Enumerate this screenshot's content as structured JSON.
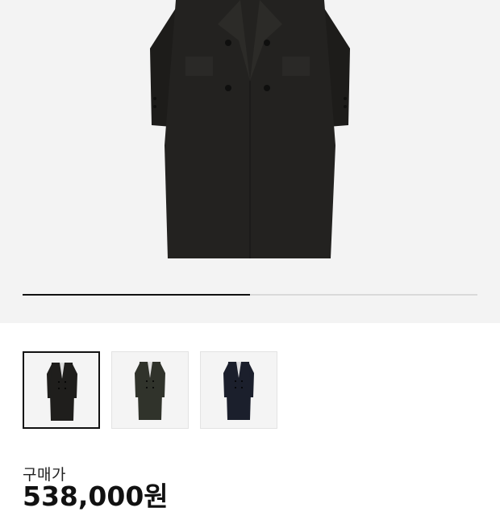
{
  "carousel": {
    "progress": 0.5,
    "colors": {
      "track": "#d9d9d9",
      "fill": "#111111"
    }
  },
  "thumbnails": [
    {
      "name": "black",
      "color": "#1f1e1c",
      "selected": true
    },
    {
      "name": "dark-olive",
      "color": "#30332b",
      "selected": false
    },
    {
      "name": "navy",
      "color": "#1b1f2c",
      "selected": false
    }
  ],
  "price": {
    "label": "구매가",
    "value": "538,000원"
  }
}
